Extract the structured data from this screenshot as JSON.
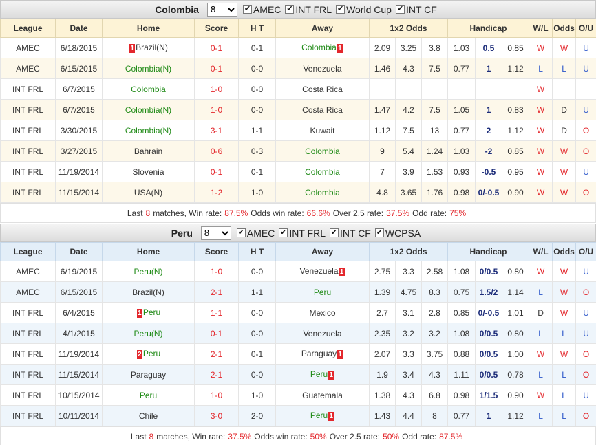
{
  "columns": [
    "League",
    "Date",
    "Home",
    "Score",
    "H T",
    "Away",
    "1x2 Odds",
    "Handicap",
    "W/L",
    "Odds",
    "O/U"
  ],
  "sections": [
    {
      "team": "Colombia",
      "count": "8",
      "filters": [
        "AMEC",
        "INT FRL",
        "World Cup",
        "INT CF"
      ],
      "rows": [
        {
          "league": "AMEC",
          "date": "6/18/2015",
          "home": "Brazil(N)",
          "home_badge": "1",
          "home_hl": false,
          "score": "0-1",
          "ht": "0-1",
          "away": "Colombia",
          "away_badge": "1",
          "away_hl": true,
          "o1": "2.09",
          "ox": "3.25",
          "o2": "3.8",
          "h1": "1.03",
          "hline": "0.5",
          "h2": "0.85",
          "wl": "W",
          "odds": "W",
          "ou": "U"
        },
        {
          "league": "AMEC",
          "date": "6/15/2015",
          "home": "Colombia(N)",
          "home_badge": "",
          "home_hl": true,
          "score": "0-1",
          "ht": "0-0",
          "away": "Venezuela",
          "away_badge": "",
          "away_hl": false,
          "o1": "1.46",
          "ox": "4.3",
          "o2": "7.5",
          "h1": "0.77",
          "hline": "1",
          "h2": "1.12",
          "wl": "L",
          "odds": "L",
          "ou": "U"
        },
        {
          "league": "INT FRL",
          "date": "6/7/2015",
          "home": "Colombia",
          "home_badge": "",
          "home_hl": true,
          "score": "1-0",
          "ht": "0-0",
          "away": "Costa Rica",
          "away_badge": "",
          "away_hl": false,
          "o1": "",
          "ox": "",
          "o2": "",
          "h1": "",
          "hline": "",
          "h2": "",
          "wl": "W",
          "odds": "",
          "ou": ""
        },
        {
          "league": "INT FRL",
          "date": "6/7/2015",
          "home": "Colombia(N)",
          "home_badge": "",
          "home_hl": true,
          "score": "1-0",
          "ht": "0-0",
          "away": "Costa Rica",
          "away_badge": "",
          "away_hl": false,
          "o1": "1.47",
          "ox": "4.2",
          "o2": "7.5",
          "h1": "1.05",
          "hline": "1",
          "h2": "0.83",
          "wl": "W",
          "odds": "D",
          "ou": "U"
        },
        {
          "league": "INT FRL",
          "date": "3/30/2015",
          "home": "Colombia(N)",
          "home_badge": "",
          "home_hl": true,
          "score": "3-1",
          "ht": "1-1",
          "away": "Kuwait",
          "away_badge": "",
          "away_hl": false,
          "o1": "1.12",
          "ox": "7.5",
          "o2": "13",
          "h1": "0.77",
          "hline": "2",
          "h2": "1.12",
          "wl": "W",
          "odds": "D",
          "ou": "O"
        },
        {
          "league": "INT FRL",
          "date": "3/27/2015",
          "home": "Bahrain",
          "home_badge": "",
          "home_hl": false,
          "score": "0-6",
          "ht": "0-3",
          "away": "Colombia",
          "away_badge": "",
          "away_hl": true,
          "o1": "9",
          "ox": "5.4",
          "o2": "1.24",
          "h1": "1.03",
          "hline": "-2",
          "h2": "0.85",
          "wl": "W",
          "odds": "W",
          "ou": "O"
        },
        {
          "league": "INT FRL",
          "date": "11/19/2014",
          "home": "Slovenia",
          "home_badge": "",
          "home_hl": false,
          "score": "0-1",
          "ht": "0-1",
          "away": "Colombia",
          "away_badge": "",
          "away_hl": true,
          "o1": "7",
          "ox": "3.9",
          "o2": "1.53",
          "h1": "0.93",
          "hline": "-0.5",
          "h2": "0.95",
          "wl": "W",
          "odds": "W",
          "ou": "U"
        },
        {
          "league": "INT FRL",
          "date": "11/15/2014",
          "home": "USA(N)",
          "home_badge": "",
          "home_hl": false,
          "score": "1-2",
          "ht": "1-0",
          "away": "Colombia",
          "away_badge": "",
          "away_hl": true,
          "o1": "4.8",
          "ox": "3.65",
          "o2": "1.76",
          "h1": "0.98",
          "hline": "0/-0.5",
          "h2": "0.90",
          "wl": "W",
          "odds": "W",
          "ou": "O"
        }
      ],
      "summary": {
        "last_pre": "Last",
        "last_n": "8",
        "win_label": "matches, Win rate:",
        "win_rate": "87.5%",
        "odds_label": "Odds win rate:",
        "odds_rate": "66.6%",
        "over_label": "Over 2.5 rate:",
        "over_rate": "37.5%",
        "odd_label": "Odd rate:",
        "odd_rate": "75%"
      }
    },
    {
      "team": "Peru",
      "count": "8",
      "filters": [
        "AMEC",
        "INT FRL",
        "INT CF",
        "WCPSA"
      ],
      "rows": [
        {
          "league": "AMEC",
          "date": "6/19/2015",
          "home": "Peru(N)",
          "home_badge": "",
          "home_hl": true,
          "score": "1-0",
          "ht": "0-0",
          "away": "Venezuela",
          "away_badge": "1",
          "away_hl": false,
          "o1": "2.75",
          "ox": "3.3",
          "o2": "2.58",
          "h1": "1.08",
          "hline": "0/0.5",
          "h2": "0.80",
          "wl": "W",
          "odds": "W",
          "ou": "U"
        },
        {
          "league": "AMEC",
          "date": "6/15/2015",
          "home": "Brazil(N)",
          "home_badge": "",
          "home_hl": false,
          "score": "2-1",
          "ht": "1-1",
          "away": "Peru",
          "away_badge": "",
          "away_hl": true,
          "o1": "1.39",
          "ox": "4.75",
          "o2": "8.3",
          "h1": "0.75",
          "hline": "1.5/2",
          "h2": "1.14",
          "wl": "L",
          "odds": "W",
          "ou": "O"
        },
        {
          "league": "INT FRL",
          "date": "6/4/2015",
          "home": "Peru",
          "home_badge": "1",
          "home_hl": true,
          "score": "1-1",
          "ht": "0-0",
          "away": "Mexico",
          "away_badge": "",
          "away_hl": false,
          "o1": "2.7",
          "ox": "3.1",
          "o2": "2.8",
          "h1": "0.85",
          "hline": "0/-0.5",
          "h2": "1.01",
          "wl": "D",
          "odds": "W",
          "ou": "U"
        },
        {
          "league": "INT FRL",
          "date": "4/1/2015",
          "home": "Peru(N)",
          "home_badge": "",
          "home_hl": true,
          "score": "0-1",
          "ht": "0-0",
          "away": "Venezuela",
          "away_badge": "",
          "away_hl": false,
          "o1": "2.35",
          "ox": "3.2",
          "o2": "3.2",
          "h1": "1.08",
          "hline": "0/0.5",
          "h2": "0.80",
          "wl": "L",
          "odds": "L",
          "ou": "U"
        },
        {
          "league": "INT FRL",
          "date": "11/19/2014",
          "home": "Peru",
          "home_badge": "2",
          "home_hl": true,
          "score": "2-1",
          "ht": "0-1",
          "away": "Paraguay",
          "away_badge": "1",
          "away_hl": false,
          "o1": "2.07",
          "ox": "3.3",
          "o2": "3.75",
          "h1": "0.88",
          "hline": "0/0.5",
          "h2": "1.00",
          "wl": "W",
          "odds": "W",
          "ou": "O"
        },
        {
          "league": "INT FRL",
          "date": "11/15/2014",
          "home": "Paraguay",
          "home_badge": "",
          "home_hl": false,
          "score": "2-1",
          "ht": "0-0",
          "away": "Peru",
          "away_badge": "1",
          "away_hl": true,
          "o1": "1.9",
          "ox": "3.4",
          "o2": "4.3",
          "h1": "1.11",
          "hline": "0/0.5",
          "h2": "0.78",
          "wl": "L",
          "odds": "L",
          "ou": "O"
        },
        {
          "league": "INT FRL",
          "date": "10/15/2014",
          "home": "Peru",
          "home_badge": "",
          "home_hl": true,
          "score": "1-0",
          "ht": "1-0",
          "away": "Guatemala",
          "away_badge": "",
          "away_hl": false,
          "o1": "1.38",
          "ox": "4.3",
          "o2": "6.8",
          "h1": "0.98",
          "hline": "1/1.5",
          "h2": "0.90",
          "wl": "W",
          "odds": "L",
          "ou": "U"
        },
        {
          "league": "INT FRL",
          "date": "10/11/2014",
          "home": "Chile",
          "home_badge": "",
          "home_hl": false,
          "score": "3-0",
          "ht": "2-0",
          "away": "Peru",
          "away_badge": "1",
          "away_hl": true,
          "o1": "1.43",
          "ox": "4.4",
          "o2": "8",
          "h1": "0.77",
          "hline": "1",
          "h2": "1.12",
          "wl": "L",
          "odds": "L",
          "ou": "O"
        }
      ],
      "summary": {
        "last_pre": "Last",
        "last_n": "8",
        "win_label": "matches, Win rate:",
        "win_rate": "37.5%",
        "odds_label": "Odds win rate:",
        "odds_rate": "50%",
        "over_label": "Over 2.5 rate:",
        "over_rate": "50%",
        "odd_label": "Odd rate:",
        "odd_rate": "87.5%"
      }
    }
  ],
  "colors": {
    "team_highlight": "#1f8a16",
    "score": "#e3272c",
    "win": "#e3272c",
    "loss": "#2a55c9",
    "badge": "#e3272c"
  },
  "icons": {
    "checkbox": "checkmark-icon",
    "select": "chevron-down-icon"
  }
}
